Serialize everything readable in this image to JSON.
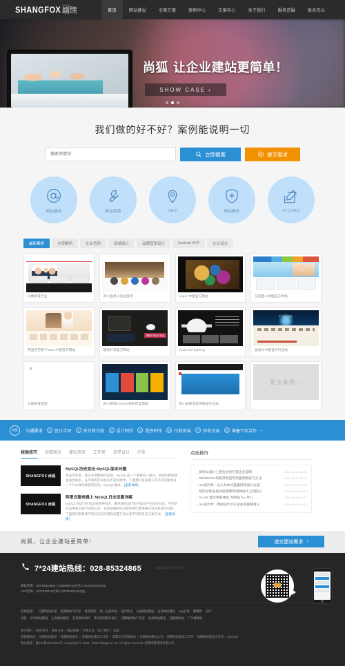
{
  "header": {
    "logo_main": "SHANGFOX",
    "logo_cn": "尚狐网络",
    "logo_tiny": "SINCE",
    "logo_sub_cn": "网络公司",
    "nav": [
      {
        "label": "首页",
        "active": true
      },
      {
        "label": "网站建设",
        "active": false
      },
      {
        "label": "全案方案",
        "active": false
      },
      {
        "label": "案例中心",
        "active": false
      },
      {
        "label": "文案中心",
        "active": false
      },
      {
        "label": "关于我们",
        "active": false
      },
      {
        "label": "服务范围",
        "active": false
      },
      {
        "label": "联合办公",
        "active": false
      }
    ]
  },
  "hero": {
    "brand": "尚狐",
    "title": "让企业建站更简单！",
    "button": "SHOW CASE",
    "button_arrow": "›",
    "dots": 3,
    "active_dot": 1
  },
  "search": {
    "title": "我们做的好不好？案例能说明一切",
    "placeholder": "搜索关键词",
    "value": "",
    "search_button": "立即搜索",
    "submit_button": "提交需求",
    "search_icon": "magnifier-icon",
    "plus_icon": "plus-circle-icon"
  },
  "services": [
    {
      "label": "网站建设",
      "icon": "at-sign-icon"
    },
    {
      "label": "网站改版",
      "icon": "wrench-icon"
    },
    {
      "label": "SEO",
      "icon": "map-pin-icon"
    },
    {
      "label": "网站维护",
      "icon": "shield-plus-icon"
    },
    {
      "label": "VI LOGO",
      "icon": "pencil-square-icon"
    }
  ],
  "case_tabs": [
    {
      "label": "最新案例",
      "active": true
    },
    {
      "label": "全部案例",
      "active": false
    },
    {
      "label": "企业官网",
      "active": false
    },
    {
      "label": "商城设计",
      "active": false
    },
    {
      "label": "品牌营销设计",
      "active": false
    },
    {
      "label": "Android APP",
      "active": false
    },
    {
      "label": "企业设计",
      "active": false
    }
  ],
  "cases": [
    {
      "caption": "众数教育行业",
      "art": "t1"
    },
    {
      "caption": "四川金果川商业官网",
      "art": "t2"
    },
    {
      "caption": "sugar 中国官方网站",
      "art": "t3"
    },
    {
      "caption": "艾丽西Ai中国官方网站",
      "art": "t4"
    },
    {
      "caption": "阿里巴巴旗下OOLI中国官方网站",
      "art": "t5"
    },
    {
      "caption": "理想灯饰官方网站",
      "art": "t6"
    },
    {
      "caption": "Tesla led lighting",
      "art": "t7"
    },
    {
      "caption": "欧泰尔中国设计行业站",
      "art": "t8"
    },
    {
      "caption": "众数教育官网",
      "art": "t9"
    },
    {
      "caption": "四川德瑞Ceremy和制定案例网",
      "art": "t10"
    },
    {
      "caption": "四川省建设装饰网站行业站",
      "art": "t11"
    }
  ],
  "more_case_label": "更多案例...",
  "process": {
    "logo_text": "尚狐",
    "steps": [
      {
        "num": "1",
        "label": "沟通需求"
      },
      {
        "num": "2",
        "label": "签订合同"
      },
      {
        "num": "3",
        "label": "支付首付款"
      },
      {
        "num": "4",
        "label": "设计制作"
      },
      {
        "num": "5",
        "label": "程序制作"
      },
      {
        "num": "6",
        "label": "付款安装"
      },
      {
        "num": "7",
        "label": "验收交易"
      },
      {
        "num": "8",
        "label": "准备下次合作"
      }
    ],
    "last_arrow": "→"
  },
  "news": {
    "tabs": [
      {
        "label": "经验技巧",
        "active": true
      },
      {
        "label": "尚狐观点",
        "active": false
      },
      {
        "label": "建站资讯",
        "active": false
      },
      {
        "label": "工作室",
        "active": false
      },
      {
        "label": "自学设计",
        "active": false
      },
      {
        "label": "IT界",
        "active": false
      }
    ],
    "items": [
      {
        "thumb_text": "SHANGFOX 尚狐",
        "title": "MySQL历史变迁-MySQL版本问题",
        "summary": "目前的开发，基于开源数据的选择，MySQL是一个重要的一部分，目前的数据库发展也很多，在不同的阶段会有不同的版本，下面我们就来看下的不同的版本有一个什么样的改变和区别，MySQL版本...",
        "more": "[查看详情]"
      },
      {
        "thumb_text": "SHANGFOX 尚狐",
        "title": "阿里云服务器上 MySQL日志设置详解",
        "summary": "MySQL在运行时会记录各种日志，服务器在运行的时候会产生很多日志，不同的日志用来记录不同的信息，在系统维护的过程中我们需要通过日志来定位问题，下面我们来看看不同日志的作用和设置方法以及不同的日志记录方式。",
        "more": "[查看详情]"
      }
    ],
    "rank_title": "点击排行",
    "rank": [
      {
        "text": "如何从设计上定位切合打造企业官网",
        "date": "2014-09-12 10:21"
      },
      {
        "text": "DEDECMS列表页和首页页面调用技巧方法",
        "date": "2014-09-12 10:18"
      },
      {
        "text": "me设计师：以人为本才是最好的设计之道",
        "date": "2014-09-11 09:45"
      },
      {
        "text": "经历过职业培训后需要有何种设计上的提升",
        "date": "2014-09-10 16:32"
      },
      {
        "text": "ALAIX 理念带来体验 为网站飞一半儿",
        "date": "2014-09-09 11:07"
      },
      {
        "text": "me设计师：网站设计对于企业的重要意义",
        "date": "2014-09-08 14:52"
      }
    ]
  },
  "cta": {
    "text": "尚狐，让企业建站更简单!",
    "button": "提交建站需求",
    "arrow": "›"
  },
  "footer": {
    "phone_icon": "phone-icon",
    "hotline": "7*24建站热线：028-85324865",
    "watermark": "成都尚狐网络科技公司",
    "contact_line1": "网站咨询：028-85324865 / 13980957630(王L) 404337264(QQ)",
    "contact_line2": "APP咨询：15176425117(刘L) 2276642512(QQ)",
    "qr_icon": "qr-code-icon",
    "phone_mock_icon": "mobile-phone-icon",
    "friend_label": "友情链接：",
    "friend_links_row1": [
      "成都网站托管",
      "成都网站工作室",
      "青海保险",
      "第一分类目录",
      "设计网上",
      "天威网站建设",
      "宜宾网站建设",
      "app开发",
      "蜀黍网",
      "设计"
    ],
    "friend_links_row2": [
      "导航",
      "沪中网站建设",
      "上海网站建设",
      "西安网站制作",
      "青海保险照片画儿",
      "成都做网站工作室",
      "攻关网站建设",
      "成都建网站",
      "广州建网站"
    ],
    "bottom_nav": [
      "关于我们",
      "服务项目",
      "联系方式",
      "网站地图",
      "付款方式",
      "加入我们",
      "前面"
    ],
    "bottom_links": [
      "成都做网站",
      "成都网站建设",
      "成都网站制作",
      "成都网站建设工作室",
      "成都工作室做网站",
      "成都网站建设公司",
      "成都网站建设工作室",
      "成都网站建设工作室",
      "Sitemap"
    ],
    "record": "蜀ICP备12014024号-2  Copyright © 2006 - 2014 ShangFox, Inc.All rights reserved.  成都尚狐网络有限公司",
    "record_prefix": "网站备案："
  }
}
